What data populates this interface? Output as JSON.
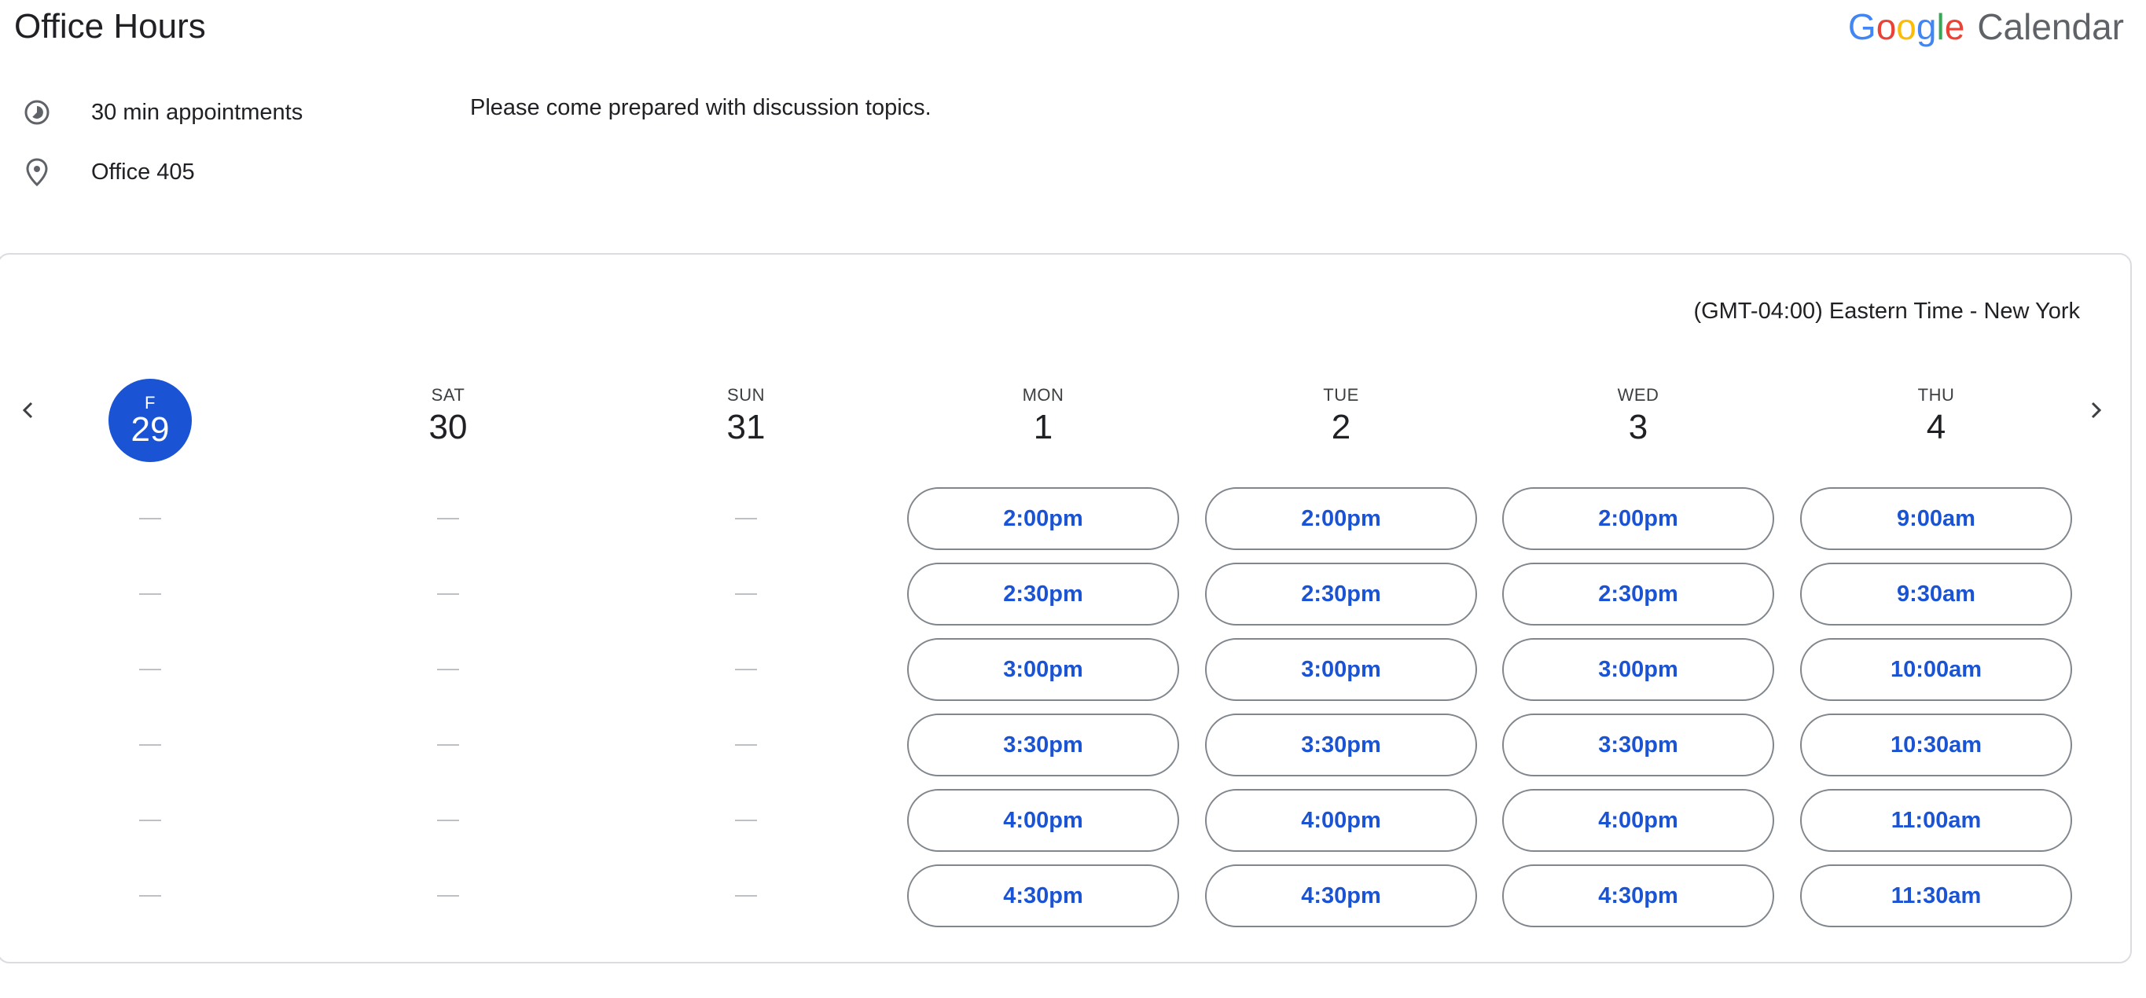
{
  "header": {
    "title": "Office Hours",
    "brand": {
      "google": [
        "G",
        "o",
        "o",
        "g",
        "l",
        "e"
      ],
      "product": "Calendar"
    }
  },
  "details": {
    "duration": "30 min appointments",
    "location": "Office 405",
    "description": "Please come prepared with discussion topics."
  },
  "scheduler": {
    "timezone": "(GMT-04:00) Eastern Time - New York",
    "days": [
      {
        "dow": "F",
        "num": "29",
        "today": true,
        "slots": []
      },
      {
        "dow": "SAT",
        "num": "30",
        "slots": []
      },
      {
        "dow": "SUN",
        "num": "31",
        "slots": []
      },
      {
        "dow": "MON",
        "num": "1",
        "slots": [
          "2:00pm",
          "2:30pm",
          "3:00pm",
          "3:30pm",
          "4:00pm",
          "4:30pm"
        ]
      },
      {
        "dow": "TUE",
        "num": "2",
        "slots": [
          "2:00pm",
          "2:30pm",
          "3:00pm",
          "3:30pm",
          "4:00pm",
          "4:30pm"
        ]
      },
      {
        "dow": "WED",
        "num": "3",
        "slots": [
          "2:00pm",
          "2:30pm",
          "3:00pm",
          "3:30pm",
          "4:00pm",
          "4:30pm"
        ]
      },
      {
        "dow": "THU",
        "num": "4",
        "slots": [
          "9:00am",
          "9:30am",
          "10:00am",
          "10:30am",
          "11:00am",
          "11:30am"
        ]
      }
    ]
  },
  "colors": {
    "accent": "#1a53d4",
    "border": "#80868b",
    "dash": "#bdc1c6"
  },
  "icons": {
    "duration": "clock-pie-icon",
    "location": "map-pin-icon",
    "prev": "chevron-left-icon",
    "next": "chevron-right-icon"
  }
}
